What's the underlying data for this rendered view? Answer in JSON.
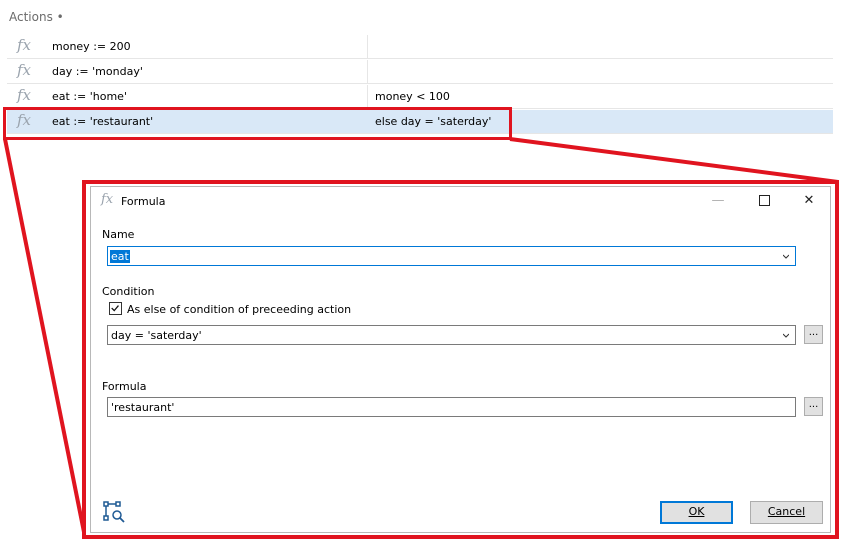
{
  "actions": {
    "title": "Actions •",
    "rows": [
      {
        "formula": "money := 200",
        "condition": ""
      },
      {
        "formula": "day := 'monday'",
        "condition": ""
      },
      {
        "formula": "eat := 'home'",
        "condition": "money < 100"
      },
      {
        "formula": "eat := 'restaurant'",
        "condition": "else day = 'saterday'"
      }
    ],
    "fx_glyph": "fx"
  },
  "dialog": {
    "title": "Formula",
    "fx_glyph": "fx",
    "window_controls": {
      "minimize": "—",
      "close": "✕"
    },
    "name_label": "Name",
    "name_value": "eat",
    "condition_label": "Condition",
    "else_checkbox_label": "As else of condition of preceeding action",
    "else_checked": true,
    "condition_value": "day = 'saterday'",
    "formula_label": "Formula",
    "formula_value": "'restaurant'",
    "ellipsis": "...",
    "ok_label": "OK",
    "cancel_label": "Cancel"
  },
  "colors": {
    "highlight": "#e0141f",
    "selection": "#d9e8f7",
    "accent": "#0078d7"
  }
}
